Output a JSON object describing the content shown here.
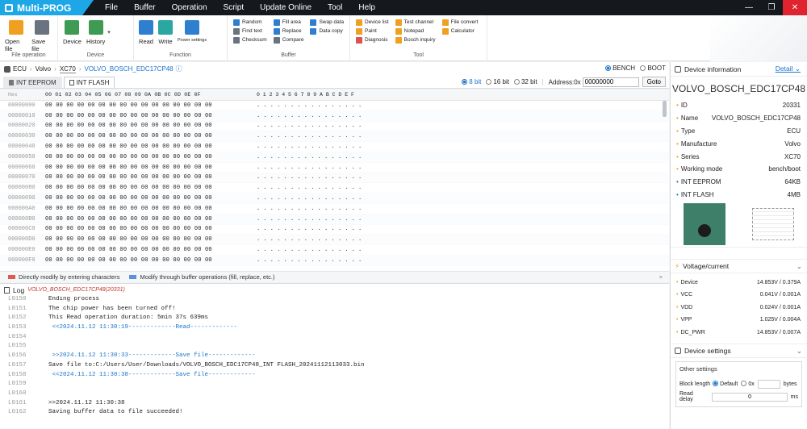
{
  "app": {
    "name": "Multi-PROG"
  },
  "menu": [
    "File",
    "Buffer",
    "Operation",
    "Script",
    "Update Online",
    "Tool",
    "Help"
  ],
  "window_buttons": {
    "minimize": "—",
    "maximize": "❐",
    "close": "✕"
  },
  "ribbon": {
    "file_operation": {
      "label": "File operation",
      "open": "Open file",
      "save": "Save file"
    },
    "device": {
      "label": "Device",
      "device": "Device",
      "history": "History"
    },
    "function": {
      "label": "Function",
      "read": "Read",
      "write": "Write",
      "power": "Power settings"
    },
    "buffer": {
      "label": "Buffer",
      "col1": [
        "Random",
        "Find text",
        "Checksum"
      ],
      "col2": [
        "Fill area",
        "Replace",
        "Compare"
      ],
      "col3": [
        "Swap data",
        "Data copy"
      ]
    },
    "tool": {
      "label": "Tool",
      "col1": [
        "Device list",
        "Paint",
        "Diagnosis"
      ],
      "col2": [
        "Test channel",
        "Notepad",
        "Bosch inquiry"
      ],
      "col3": [
        "File convert",
        "Calculator"
      ]
    }
  },
  "breadcrumb": {
    "items": [
      "ECU",
      "Volvo",
      "XC70",
      "VOLVO_BOSCH_EDC17CP48"
    ],
    "info": "ⓘ"
  },
  "mode": {
    "bench": "BENCH",
    "boot": "BOOT",
    "selected": "BENCH"
  },
  "tabs": [
    {
      "label": "INT EEPROM",
      "active": false
    },
    {
      "label": "INT FLASH",
      "active": true
    }
  ],
  "view": {
    "bit8": "8 bit",
    "bit16": "16 bit",
    "bit32": "32 bit",
    "selected": "8 bit",
    "address_label": "Address:0x",
    "address_value": "00000000",
    "goto": "Goto"
  },
  "hex": {
    "head_addr": "Hex",
    "head_bytes": "00 01 02 03 04 05 06 07 08 09 0A 0B 0C 0D 0E 0F",
    "head_ascii": "0 1 2 3 4 5 6 7 8 9 A B C D E F",
    "rows": [
      {
        "addr": "00000000",
        "bytes": "00 00 00 00 00 00 00 00 00 00 00 00 00 00 00 00",
        "ascii": ". . . . . . . . . . . . . . . ."
      },
      {
        "addr": "00000010",
        "bytes": "00 00 00 00 00 00 00 00 00 00 00 00 00 00 00 00",
        "ascii": ". . . . . . . . . . . . . . . ."
      },
      {
        "addr": "00000020",
        "bytes": "00 00 00 00 00 00 00 00 00 00 00 00 00 00 00 00",
        "ascii": ". . . . . . . . . . . . . . . ."
      },
      {
        "addr": "00000030",
        "bytes": "00 00 00 00 00 00 00 00 00 00 00 00 00 00 00 00",
        "ascii": ". . . . . . . . . . . . . . . ."
      },
      {
        "addr": "00000040",
        "bytes": "00 00 00 00 00 00 00 00 00 00 00 00 00 00 00 00",
        "ascii": ". . . . . . . . . . . . . . . ."
      },
      {
        "addr": "00000050",
        "bytes": "00 00 00 00 00 00 00 00 00 00 00 00 00 00 00 00",
        "ascii": ". . . . . . . . . . . . . . . ."
      },
      {
        "addr": "00000060",
        "bytes": "00 00 00 00 00 00 00 00 00 00 00 00 00 00 00 00",
        "ascii": ". . . . . . . . . . . . . . . ."
      },
      {
        "addr": "00000070",
        "bytes": "00 00 00 00 00 00 00 00 00 00 00 00 00 00 00 00",
        "ascii": ". . . . . . . . . . . . . . . ."
      },
      {
        "addr": "00000080",
        "bytes": "00 00 00 00 00 00 00 00 00 00 00 00 00 00 00 00",
        "ascii": ". . . . . . . . . . . . . . . ."
      },
      {
        "addr": "00000090",
        "bytes": "00 00 00 00 00 00 00 00 00 00 00 00 00 00 00 00",
        "ascii": ". . . . . . . . . . . . . . . ."
      },
      {
        "addr": "000000A0",
        "bytes": "00 00 00 00 00 00 00 00 00 00 00 00 00 00 00 00",
        "ascii": ". . . . . . . . . . . . . . . ."
      },
      {
        "addr": "000000B0",
        "bytes": "00 00 00 00 00 00 00 00 00 00 00 00 00 00 00 00",
        "ascii": ". . . . . . . . . . . . . . . ."
      },
      {
        "addr": "000000C0",
        "bytes": "00 00 00 00 00 00 00 00 00 00 00 00 00 00 00 00",
        "ascii": ". . . . . . . . . . . . . . . ."
      },
      {
        "addr": "000000D0",
        "bytes": "00 00 00 00 00 00 00 00 00 00 00 00 00 00 00 00",
        "ascii": ". . . . . . . . . . . . . . . ."
      },
      {
        "addr": "000000E0",
        "bytes": "00 00 00 00 00 00 00 00 00 00 00 00 00 00 00 00",
        "ascii": ". . . . . . . . . . . . . . . ."
      },
      {
        "addr": "000000F0",
        "bytes": "00 00 00 00 00 00 00 00 00 00 00 00 00 00 00 00",
        "ascii": ". . . . . . . . . . . . . . . ."
      }
    ]
  },
  "hints": {
    "direct": "Directly modify by entering characters",
    "buffer": "Modify through buffer operations (fill, replace, etc.)",
    "direct_color": "#e05a4f",
    "buffer_color": "#5b8fe0"
  },
  "log": {
    "title": "Log",
    "device": "VOLVO_BOSCH_EDC17CP48(20331)",
    "lines": [
      {
        "n": "L0150",
        "t": "Ending process",
        "blue": false
      },
      {
        "n": "L0151",
        "t": "The chip power has been turned off!",
        "blue": false
      },
      {
        "n": "L0152",
        "t": "This Read operation duration: 5min 37s 639ms",
        "blue": false
      },
      {
        "n": "L0153",
        "t": " <<2024.11.12 11:30:19-------------Read-------------",
        "blue": true
      },
      {
        "n": "L0154",
        "t": "",
        "blue": false
      },
      {
        "n": "L0155",
        "t": "",
        "blue": false
      },
      {
        "n": "L0156",
        "t": " >>2024.11.12 11:30:33-------------Save file-------------",
        "blue": true
      },
      {
        "n": "L0157",
        "t": "Save file to:C:/Users/User/Downloads/VOLVO_BOSCH_EDC17CP48_INT FLASH_20241112113033.bin",
        "blue": false
      },
      {
        "n": "L0158",
        "t": " <<2024.11.12 11:30:38-------------Save file-------------",
        "blue": true
      },
      {
        "n": "L0159",
        "t": "",
        "blue": false
      },
      {
        "n": "L0160",
        "t": "",
        "blue": false
      },
      {
        "n": "L0161",
        "t": ">>2024.11.12 11:30:38",
        "blue": false
      },
      {
        "n": "L0162",
        "t": "Saving buffer data to file succeeded!",
        "blue": false
      }
    ]
  },
  "device_info": {
    "title": "Device information",
    "detail": "Detail",
    "name": "VOLVO_BOSCH_EDC17CP48",
    "fields": [
      {
        "k": "ID",
        "v": "20331",
        "blue": false
      },
      {
        "k": "Name",
        "v": "VOLVO_BOSCH_EDC17CP48",
        "blue": false
      },
      {
        "k": "Type",
        "v": "ECU",
        "blue": false
      },
      {
        "k": "Manufacture",
        "v": "Volvo",
        "blue": false
      },
      {
        "k": "Series",
        "v": "XC70",
        "blue": false
      },
      {
        "k": "Working mode",
        "v": "bench/boot",
        "blue": false
      },
      {
        "k": "INT EEPROM",
        "v": "64KB",
        "blue": true
      },
      {
        "k": "INT FLASH",
        "v": "4MB",
        "blue": true
      }
    ]
  },
  "voltage": {
    "title": "Voltage/current",
    "rows": [
      {
        "k": "Device",
        "v": "14.853V / 0.379A"
      },
      {
        "k": "VCC",
        "v": "0.041V / 0.001A"
      },
      {
        "k": "VDD",
        "v": "0.024V / 0.001A"
      },
      {
        "k": "VPP",
        "v": "1.025V / 0.004A"
      },
      {
        "k": "DC_PWR",
        "v": "14.853V / 0.007A"
      }
    ]
  },
  "settings": {
    "title": "Device settings",
    "other": "Other settings",
    "block_label": "Block length",
    "default": "Default",
    "ox": "0x",
    "bytes": "bytes",
    "read_delay": "Read delay",
    "read_delay_value": "0",
    "ms": "ms"
  }
}
